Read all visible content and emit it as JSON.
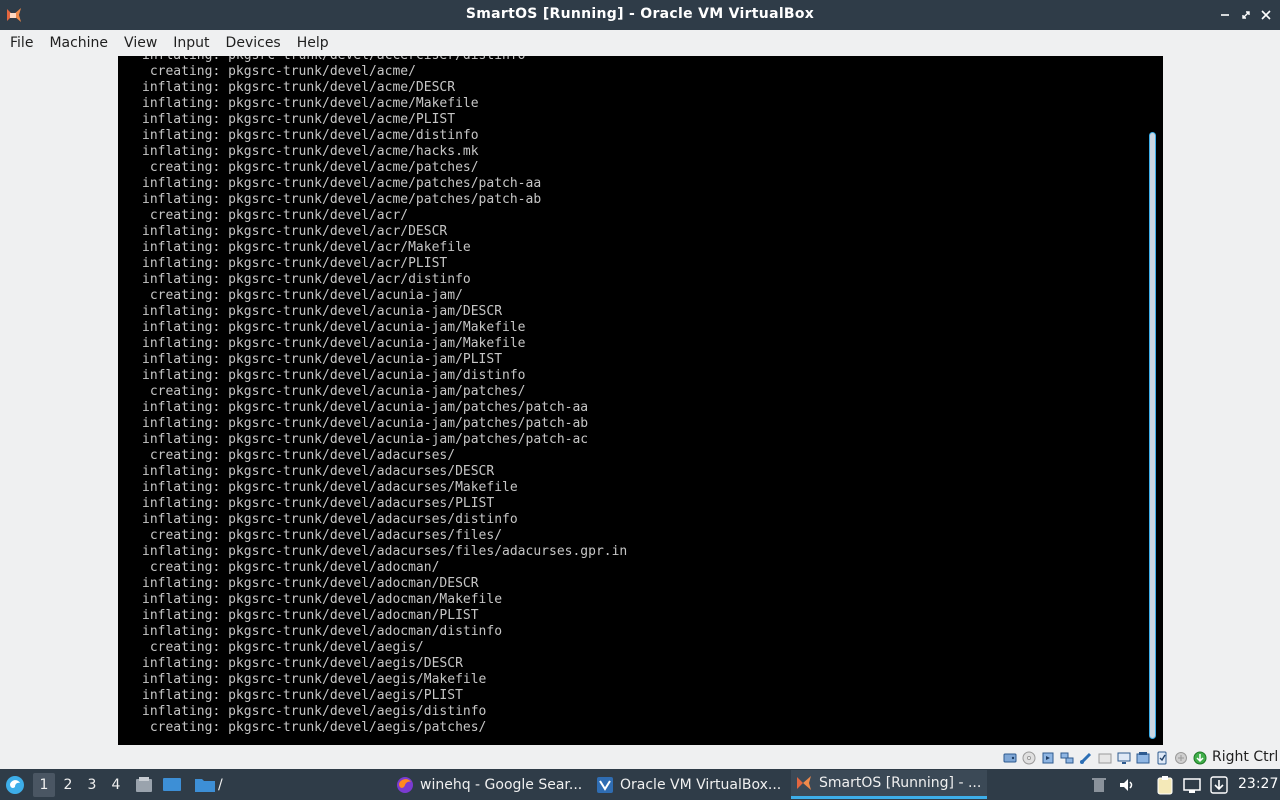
{
  "window": {
    "title": "SmartOS [Running] - Oracle VM VirtualBox",
    "app_icon": "virtualbox-app-icon",
    "buttons": [
      "minimize-icon",
      "maximize-icon",
      "close-icon"
    ]
  },
  "menu": {
    "items": [
      "File",
      "Machine",
      "View",
      "Input",
      "Devices",
      "Help"
    ]
  },
  "console": {
    "lines": [
      "inflating: pkgsrc-trunk/devel/accerciser/distinfo",
      " creating: pkgsrc-trunk/devel/acme/",
      "inflating: pkgsrc-trunk/devel/acme/DESCR",
      "inflating: pkgsrc-trunk/devel/acme/Makefile",
      "inflating: pkgsrc-trunk/devel/acme/PLIST",
      "inflating: pkgsrc-trunk/devel/acme/distinfo",
      "inflating: pkgsrc-trunk/devel/acme/hacks.mk",
      " creating: pkgsrc-trunk/devel/acme/patches/",
      "inflating: pkgsrc-trunk/devel/acme/patches/patch-aa",
      "inflating: pkgsrc-trunk/devel/acme/patches/patch-ab",
      " creating: pkgsrc-trunk/devel/acr/",
      "inflating: pkgsrc-trunk/devel/acr/DESCR",
      "inflating: pkgsrc-trunk/devel/acr/Makefile",
      "inflating: pkgsrc-trunk/devel/acr/PLIST",
      "inflating: pkgsrc-trunk/devel/acr/distinfo",
      " creating: pkgsrc-trunk/devel/acunia-jam/",
      "inflating: pkgsrc-trunk/devel/acunia-jam/DESCR",
      "inflating: pkgsrc-trunk/devel/acunia-jam/Makefile",
      "inflating: pkgsrc-trunk/devel/acunia-jam/Makefile",
      "inflating: pkgsrc-trunk/devel/acunia-jam/PLIST",
      "inflating: pkgsrc-trunk/devel/acunia-jam/distinfo",
      " creating: pkgsrc-trunk/devel/acunia-jam/patches/",
      "inflating: pkgsrc-trunk/devel/acunia-jam/patches/patch-aa",
      "inflating: pkgsrc-trunk/devel/acunia-jam/patches/patch-ab",
      "inflating: pkgsrc-trunk/devel/acunia-jam/patches/patch-ac",
      " creating: pkgsrc-trunk/devel/adacurses/",
      "inflating: pkgsrc-trunk/devel/adacurses/DESCR",
      "inflating: pkgsrc-trunk/devel/adacurses/Makefile",
      "inflating: pkgsrc-trunk/devel/adacurses/PLIST",
      "inflating: pkgsrc-trunk/devel/adacurses/distinfo",
      " creating: pkgsrc-trunk/devel/adacurses/files/",
      "inflating: pkgsrc-trunk/devel/adacurses/files/adacurses.gpr.in",
      " creating: pkgsrc-trunk/devel/adocman/",
      "inflating: pkgsrc-trunk/devel/adocman/DESCR",
      "inflating: pkgsrc-trunk/devel/adocman/Makefile",
      "inflating: pkgsrc-trunk/devel/adocman/PLIST",
      "inflating: pkgsrc-trunk/devel/adocman/distinfo",
      " creating: pkgsrc-trunk/devel/aegis/",
      "inflating: pkgsrc-trunk/devel/aegis/DESCR",
      "inflating: pkgsrc-trunk/devel/aegis/Makefile",
      "inflating: pkgsrc-trunk/devel/aegis/PLIST",
      "inflating: pkgsrc-trunk/devel/aegis/distinfo",
      " creating: pkgsrc-trunk/devel/aegis/patches/"
    ]
  },
  "statusbar": {
    "icons": [
      "hard-disk-icon",
      "optical-drive-icon",
      "audio-icon",
      "network-icon",
      "usb-icon",
      "shared-folder-icon",
      "display-icon",
      "capture-icon",
      "recording-icon",
      "cpu-icon",
      "mouse-integration-icon",
      "host-key-icon"
    ],
    "host_key": "Right Ctrl"
  },
  "taskbar": {
    "start_icon": "start-menu-icon",
    "workspaces": [
      "1",
      "2",
      "3",
      "4"
    ],
    "launchers": [
      "file-manager-icon",
      "desktop-icon",
      "folder-icon"
    ],
    "path_label": "/",
    "tasks": [
      {
        "label": "winehq - Google Sear...",
        "icon": "firefox-icon"
      },
      {
        "label": "Oracle VM VirtualBox...",
        "icon": "virtualbox-icon"
      },
      {
        "label": "SmartOS [Running] - ...",
        "icon": "virtualbox-vm-icon"
      }
    ],
    "tray": [
      "trash-icon",
      "volume-icon",
      "clipboard-icon",
      "network-tray-icon",
      "updates-icon"
    ],
    "clock": "23:27"
  }
}
